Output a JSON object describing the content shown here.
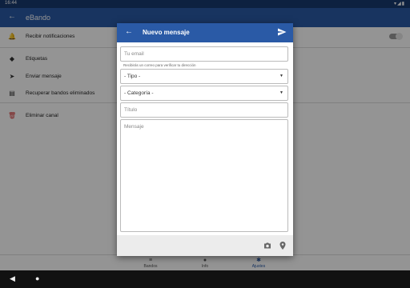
{
  "status_bar": {
    "time": "16:44",
    "icons": [
      "wifi-icon",
      "signal-icon",
      "battery-icon"
    ]
  },
  "app_bar": {
    "title": "eBando",
    "back_icon": "arrow-left-icon"
  },
  "settings": [
    {
      "label": "Recibir notificaciones",
      "icon": "bell-icon",
      "toggle": true
    },
    {
      "label": "Etiquetas",
      "icon": "tag-icon"
    },
    {
      "label": "Enviar mensaje",
      "icon": "send-icon"
    },
    {
      "label": "Recuperar bandos eliminados",
      "icon": "restore-icon"
    },
    {
      "label": "Eliminar canal",
      "icon": "trash-icon",
      "color": "#d32f2f"
    }
  ],
  "bottom_nav": [
    {
      "label": "Bandos",
      "icon": "list-icon"
    },
    {
      "label": "Info",
      "icon": "info-icon"
    },
    {
      "label": "Ajustes",
      "icon": "gear-icon",
      "active": true
    }
  ],
  "dialog": {
    "title": "Nuevo mensaje",
    "email_placeholder": "Tu email",
    "email_helper": "Recibirás un correo para verificar tu dirección",
    "tipo_value": "- Tipo -",
    "categoria_value": "- Categoría -",
    "titulo_placeholder": "Título",
    "mensaje_placeholder": "Mensaje",
    "footer_icons": [
      "camera-icon",
      "location-pin-icon"
    ]
  },
  "colors": {
    "primary": "#2a5aa6",
    "status_bar": "#173a6e",
    "danger": "#d32f2f"
  }
}
